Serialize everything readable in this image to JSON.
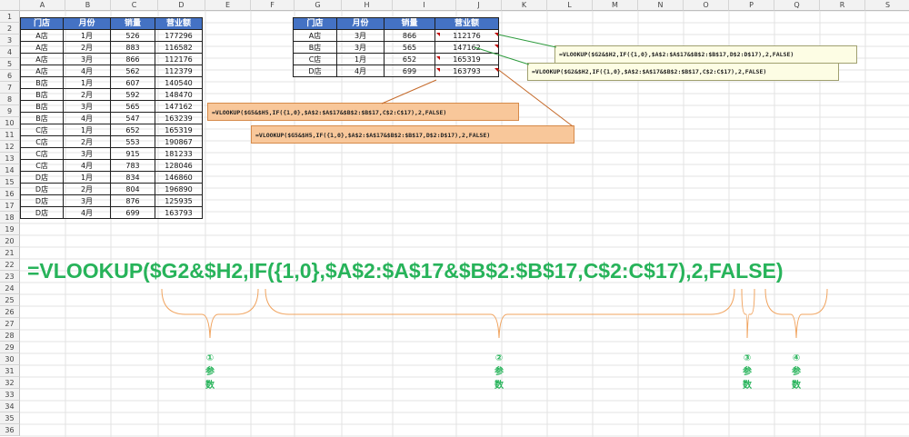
{
  "columns": [
    "A",
    "B",
    "C",
    "D",
    "E",
    "F",
    "G",
    "H",
    "I",
    "J",
    "K",
    "L",
    "M",
    "N",
    "O",
    "P",
    "Q",
    "R",
    "S"
  ],
  "rows": [
    "1",
    "2",
    "3",
    "4",
    "5",
    "6",
    "7",
    "8",
    "9",
    "10",
    "11",
    "12",
    "13",
    "14",
    "15",
    "16",
    "17",
    "18",
    "19",
    "20",
    "21",
    "22",
    "23",
    "24",
    "25",
    "26",
    "27",
    "28",
    "29",
    "30",
    "31",
    "32",
    "33",
    "34",
    "35",
    "36"
  ],
  "left_table": {
    "headers": [
      "门店",
      "月份",
      "销量",
      "营业额"
    ],
    "rows": [
      [
        "A店",
        "1月",
        "526",
        "177296"
      ],
      [
        "A店",
        "2月",
        "883",
        "116582"
      ],
      [
        "A店",
        "3月",
        "866",
        "112176"
      ],
      [
        "A店",
        "4月",
        "562",
        "112379"
      ],
      [
        "B店",
        "1月",
        "607",
        "140540"
      ],
      [
        "B店",
        "2月",
        "592",
        "148470"
      ],
      [
        "B店",
        "3月",
        "565",
        "147162"
      ],
      [
        "B店",
        "4月",
        "547",
        "163239"
      ],
      [
        "C店",
        "1月",
        "652",
        "165319"
      ],
      [
        "C店",
        "2月",
        "553",
        "190867"
      ],
      [
        "C店",
        "3月",
        "915",
        "181233"
      ],
      [
        "C店",
        "4月",
        "783",
        "128046"
      ],
      [
        "D店",
        "1月",
        "834",
        "146860"
      ],
      [
        "D店",
        "2月",
        "804",
        "196890"
      ],
      [
        "D店",
        "3月",
        "876",
        "125935"
      ],
      [
        "D店",
        "4月",
        "699",
        "163793"
      ]
    ]
  },
  "right_table": {
    "headers": [
      "门店",
      "月份",
      "销量",
      "营业额"
    ],
    "rows": [
      [
        "A店",
        "3月",
        "866",
        "112176"
      ],
      [
        "B店",
        "3月",
        "565",
        "147162"
      ],
      [
        "C店",
        "1月",
        "652",
        "165319"
      ],
      [
        "D店",
        "4月",
        "699",
        "163793"
      ]
    ]
  },
  "notes": {
    "yellow_1": "=VLOOKUP($G2&$H2,IF({1,0},$A$2:$A$17&$B$2:$B$17,D$2:D$17),2,FALSE)",
    "yellow_2": "=VLOOKUP($G2&$H2,IF({1,0},$A$2:$A$17&$B$2:$B$17,C$2:C$17),2,FALSE)",
    "orange_1": "=VLOOKUP($G5&$H5,IF({1,0},$A$2:$A$17&$B$2:$B$17,C$2:C$17),2,FALSE)",
    "orange_2": "=VLOOKUP($G5&$H5,IF({1,0},$A$2:$A$17&$B$2:$B$17,D$2:D$17),2,FALSE)"
  },
  "formula": {
    "p1": "=VLOOKUP(",
    "p2": "$G2&$H2,",
    "p3": "IF({1,0},$A$2:$A$17&$B$2:$B$17,C$2:C$17),",
    "p4": "2,",
    "p5": "FALSE)"
  },
  "params": [
    {
      "num": "①",
      "c1": "参",
      "c2": "数"
    },
    {
      "num": "②",
      "c1": "参",
      "c2": "数"
    },
    {
      "num": "③",
      "c1": "参",
      "c2": "数"
    },
    {
      "num": "④",
      "c1": "参",
      "c2": "数"
    }
  ],
  "colors": {
    "header_blue": "#4472c4",
    "formula_green": "#27b35a",
    "brace_orange": "#f0a35e",
    "note_orange": "#f8c79a",
    "note_yellow": "#fdfde4"
  }
}
